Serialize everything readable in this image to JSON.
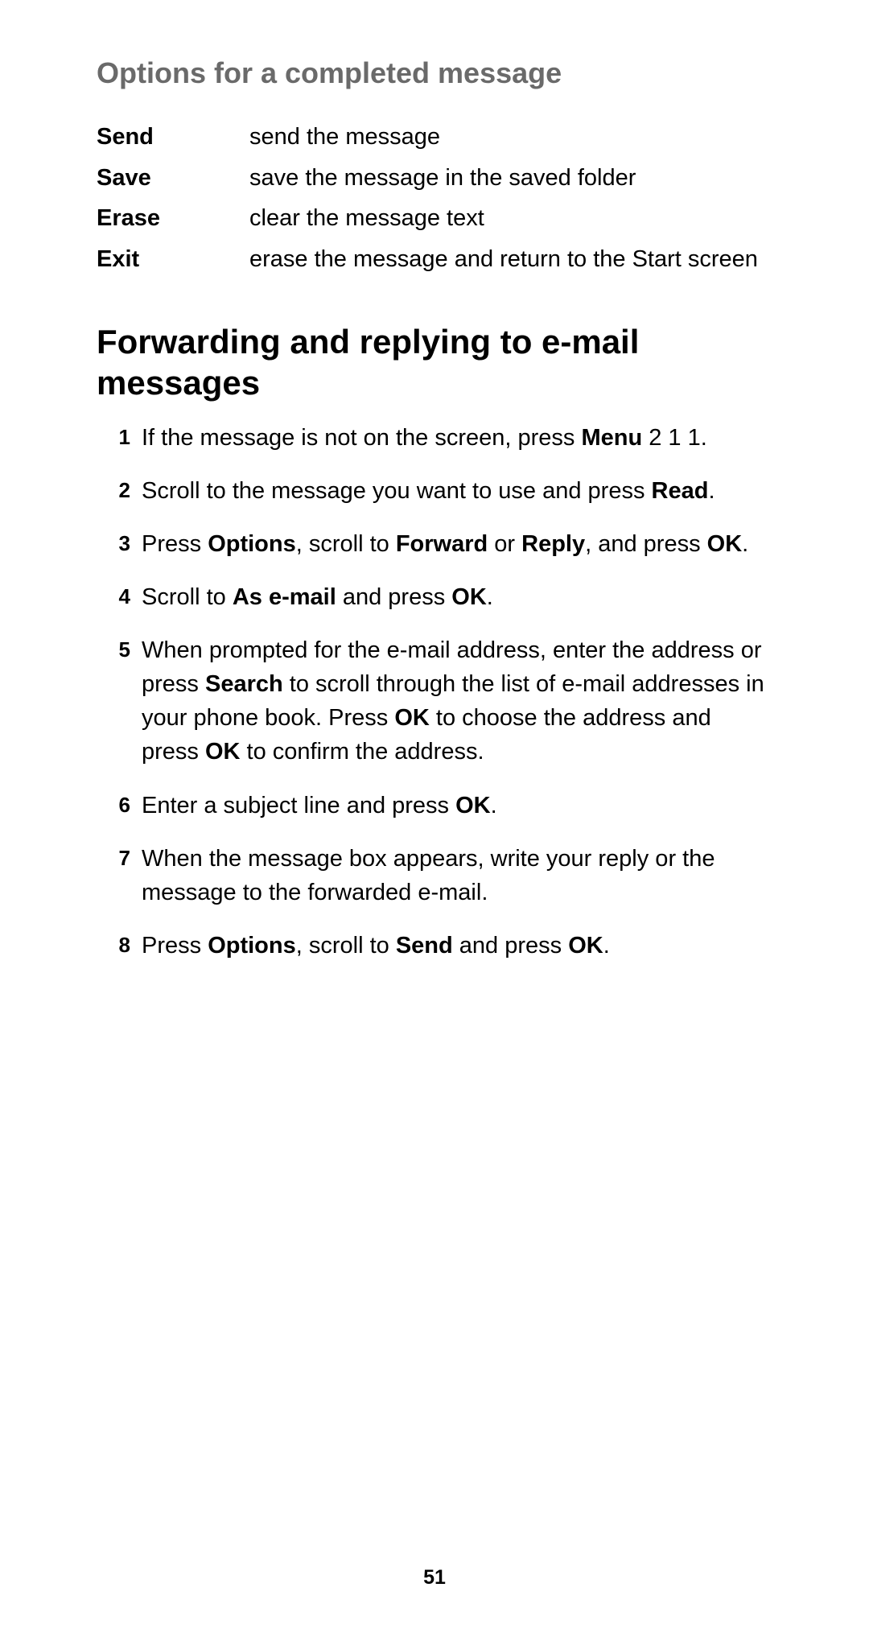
{
  "subheading": "Options for a completed message",
  "options": [
    {
      "term": "Send",
      "desc": "send the message"
    },
    {
      "term": "Save",
      "desc": "save the message in the saved folder"
    },
    {
      "term": "Erase",
      "desc": "clear the message text"
    },
    {
      "term": "Exit",
      "desc": "erase the message and return to the Start screen"
    }
  ],
  "main_heading": "Forwarding and replying to e-mail messages",
  "steps": [
    {
      "num": "1",
      "parts": [
        {
          "t": "If the message is not on the screen, press "
        },
        {
          "t": "Menu",
          "b": true
        },
        {
          "t": " 2 1 1."
        }
      ]
    },
    {
      "num": "2",
      "parts": [
        {
          "t": "Scroll to the message you want to use and press "
        },
        {
          "t": "Read",
          "b": true
        },
        {
          "t": "."
        }
      ]
    },
    {
      "num": "3",
      "parts": [
        {
          "t": "Press "
        },
        {
          "t": "Options",
          "b": true
        },
        {
          "t": ", scroll to "
        },
        {
          "t": "Forward",
          "b": true
        },
        {
          "t": " or "
        },
        {
          "t": "Reply",
          "b": true
        },
        {
          "t": ", and press "
        },
        {
          "t": "OK",
          "b": true
        },
        {
          "t": "."
        }
      ]
    },
    {
      "num": "4",
      "parts": [
        {
          "t": "Scroll to "
        },
        {
          "t": "As e-mail",
          "b": true
        },
        {
          "t": " and press "
        },
        {
          "t": "OK",
          "b": true
        },
        {
          "t": "."
        }
      ]
    },
    {
      "num": "5",
      "parts": [
        {
          "t": "When prompted for the e-mail address, enter the address or press "
        },
        {
          "t": "Search",
          "b": true
        },
        {
          "t": " to scroll through the list of e-mail addresses in your phone book. Press "
        },
        {
          "t": "OK",
          "b": true
        },
        {
          "t": " to choose the address and press "
        },
        {
          "t": "OK",
          "b": true
        },
        {
          "t": " to confirm the address."
        }
      ]
    },
    {
      "num": "6",
      "parts": [
        {
          "t": "Enter a subject line and press "
        },
        {
          "t": "OK",
          "b": true
        },
        {
          "t": "."
        }
      ]
    },
    {
      "num": "7",
      "parts": [
        {
          "t": "When the message box appears, write your reply or the message to the forwarded e-mail."
        }
      ]
    },
    {
      "num": "8",
      "parts": [
        {
          "t": "Press "
        },
        {
          "t": "Options",
          "b": true
        },
        {
          "t": ", scroll to "
        },
        {
          "t": "Send",
          "b": true
        },
        {
          "t": " and press "
        },
        {
          "t": "OK",
          "b": true
        },
        {
          "t": "."
        }
      ]
    }
  ],
  "page_number": "51"
}
